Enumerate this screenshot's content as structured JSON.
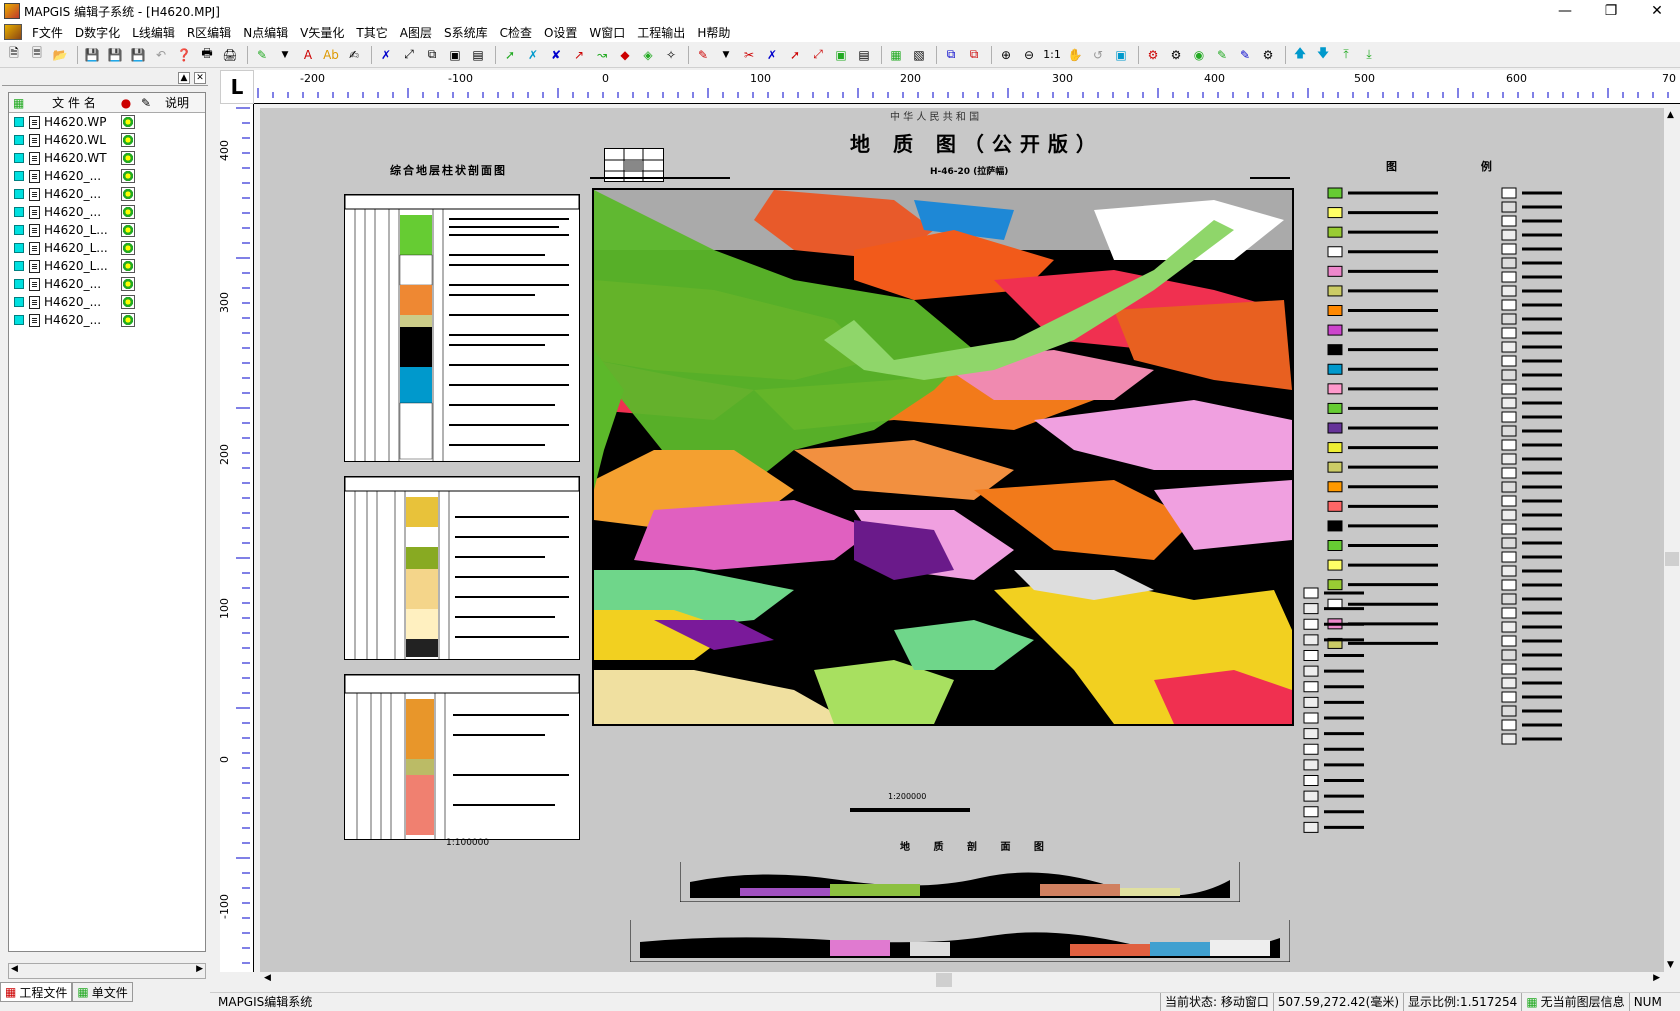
{
  "window": {
    "title": "MAPGIS 编辑子系统 - [H4620.MPJ]"
  },
  "menu": [
    "F文件",
    "D数字化",
    "L线编辑",
    "R区编辑",
    "N点编辑",
    "V矢量化",
    "T其它",
    "A图层",
    "S系统库",
    "C检查",
    "O设置",
    "W窗口",
    "工程输出",
    "H帮助"
  ],
  "panel": {
    "header_name": "文 件 名",
    "header_desc": "说明",
    "files": [
      "H4620.WP",
      "H4620.WL",
      "H4620.WT",
      "H4620_...",
      "H4620_...",
      "H4620_...",
      "H4620_L...",
      "H4620_L...",
      "H4620_L...",
      "H4620_...",
      "H4620_...",
      "H4620_..."
    ],
    "tabs": [
      "工程文件",
      "单文件"
    ]
  },
  "ruler": {
    "h_labels": [
      "-200",
      "-100",
      "0",
      "100",
      "200",
      "300",
      "400",
      "500",
      "600",
      "70"
    ],
    "v_labels": [
      "400",
      "300",
      "200",
      "100",
      "0",
      "-100"
    ],
    "corner": "L"
  },
  "map": {
    "title": "地 质 图（公开版）",
    "top_strip": "中 华 人 民 共 和 国",
    "sheet_code": "H-46-20 (拉萨幅)",
    "column_title": "综合地层柱状剖面图",
    "legend_title": "图 例",
    "section_title": "地 质 剖 面 图",
    "scale_main": "1:200000",
    "scale_col": "1:100000"
  },
  "status": {
    "app_name": "MAPGIS编辑系统",
    "state": "当前状态: 移动窗口",
    "coords": "507.59,272.42(毫米)",
    "scale": "显示比例:1.517254",
    "layer": "无当前图层信息",
    "num": "NUM"
  },
  "colors": {
    "canvas": "#c8c8c8",
    "ruler_tick": "#0000cc"
  }
}
